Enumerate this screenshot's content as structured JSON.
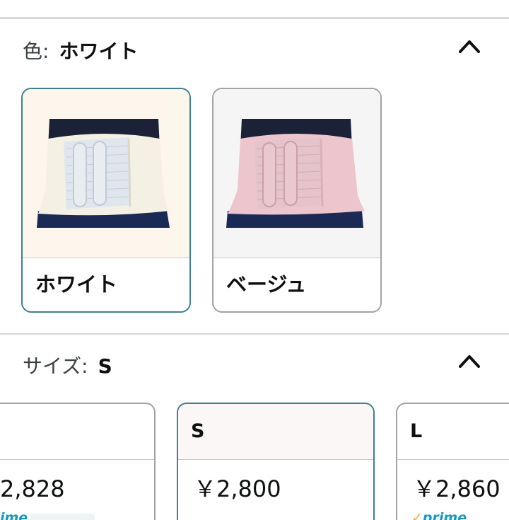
{
  "color_section": {
    "label": "色:",
    "selected_value": "ホワイト",
    "options": [
      {
        "name": "ホワイト",
        "selected": true
      },
      {
        "name": "ベージュ",
        "selected": false
      }
    ]
  },
  "size_section": {
    "label": "サイズ:",
    "selected_value": "S",
    "options": [
      {
        "name": "",
        "price": "2,828",
        "prime": "ime",
        "selected": false
      },
      {
        "name": "S",
        "price": "￥2,800",
        "selected": true
      },
      {
        "name": "L",
        "price": "￥2,860",
        "prime": "prime",
        "selected": false
      }
    ]
  },
  "icons": {
    "collapse": "chevron-up-icon",
    "prime_check": "check-icon"
  },
  "colors": {
    "selected_border": "#3e808c",
    "unselected_border": "#a3a3a3",
    "prime_blue": "#1399c6",
    "prime_check": "#f3a847",
    "divider": "#d5d9d9"
  }
}
